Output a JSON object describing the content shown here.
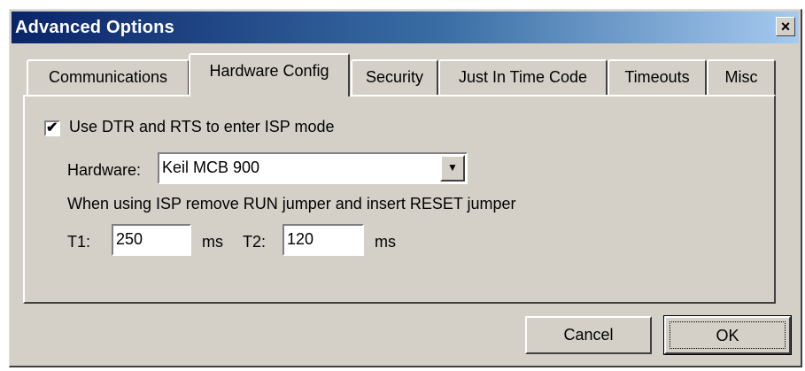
{
  "window": {
    "title": "Advanced Options",
    "close_glyph": "×"
  },
  "tabs": [
    {
      "label": "Communications",
      "active": false
    },
    {
      "label": "Hardware Config",
      "active": true
    },
    {
      "label": "Security",
      "active": false
    },
    {
      "label": "Just In Time Code",
      "active": false
    },
    {
      "label": "Timeouts",
      "active": false
    },
    {
      "label": "Misc",
      "active": false
    }
  ],
  "hardware_config": {
    "use_dtr_rts": {
      "label": "Use DTR and RTS to enter ISP mode",
      "checked": true,
      "check_glyph": "✔"
    },
    "hardware_label": "Hardware:",
    "hardware_value": "Keil MCB 900",
    "dropdown_glyph": "▼",
    "note": "When using ISP remove RUN jumper and insert RESET jumper",
    "t1_label": "T1:",
    "t1_value": "250",
    "t1_unit": "ms",
    "t2_label": "T2:",
    "t2_value": "120",
    "t2_unit": "ms"
  },
  "buttons": {
    "cancel": "Cancel",
    "ok": "OK"
  },
  "colors": {
    "face": "#d4d0c8",
    "title_start": "#0a246a",
    "title_end": "#a6caf0"
  },
  "icons": {
    "close": "close-icon",
    "check": "checkmark-icon",
    "dropdown": "chevron-down-icon"
  }
}
